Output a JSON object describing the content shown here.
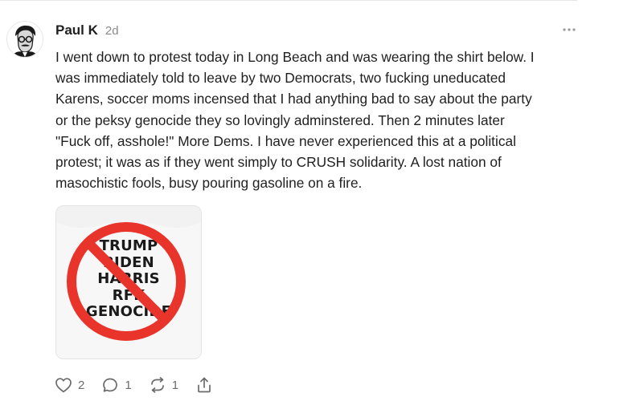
{
  "comment": {
    "author": "Paul K",
    "time": "2d",
    "body": "I went down to protest today in Long Beach and was wearing the shirt below. I\nwas immediately told to leave by two Democrats, two fucking uneducated\nKarens, soccer moms incensed that I had anything bad to say about the party\nor the peksy genocide they so lovingly adminstered. Then 2 minutes later\n\"Fuck off, asshole!\" More Dems. I have never experienced this at a political\nprotest; it was as if they went simply to CRUSH solidarity. A lost nation of\nmasochistic fools, busy pouring gasoline on a fire.",
    "image": {
      "shirt_lines": [
        "TRUMP",
        "BIDEN",
        "HARRIS",
        "RFK",
        "GENOCIDE"
      ],
      "prohibition_color": "#e8342b"
    }
  },
  "actions": {
    "likes": "2",
    "replies": "1",
    "restacks": "1"
  },
  "icons": {
    "more": "more-horizontal-icon",
    "like": "heart-icon",
    "reply": "comment-icon",
    "restack": "restack-icon",
    "share": "share-icon"
  }
}
